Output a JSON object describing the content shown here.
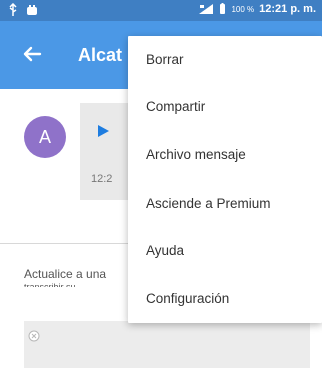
{
  "status_bar": {
    "battery_percent": "100 %",
    "time": "12:21 p. m.",
    "icons": [
      "usb-icon",
      "android-icon",
      "signal-icon",
      "battery-icon"
    ]
  },
  "toolbar": {
    "title": "Alcat",
    "back_icon": "back-arrow-icon"
  },
  "conversation": {
    "avatar_letter": "A",
    "message_time": "12:2",
    "update_text": "Actualice a una",
    "update_subtext": "transcribir su"
  },
  "menu": {
    "items": [
      {
        "label": "Borrar"
      },
      {
        "label": "Compartir"
      },
      {
        "label": "Archivo mensaje"
      },
      {
        "label": "Asciende a Premium"
      },
      {
        "label": "Ayuda"
      },
      {
        "label": "Configuración"
      }
    ]
  },
  "colors": {
    "status_bar": "#3f7fc3",
    "toolbar": "#4b98e6",
    "avatar": "#8f72c9",
    "play_icon": "#1e7de0"
  }
}
